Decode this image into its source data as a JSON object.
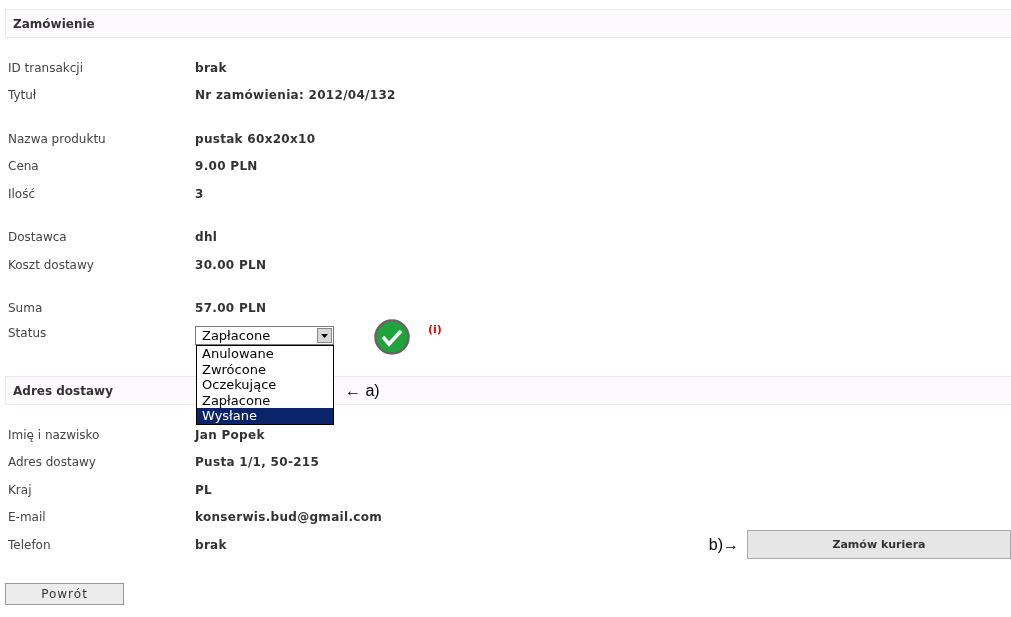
{
  "order": {
    "title": "Zamówienie",
    "groups": [
      [
        {
          "label": "ID transakcji",
          "value": "brak"
        },
        {
          "label": "Tytuł",
          "value": "Nr zamówienia: 2012/04/132"
        }
      ],
      [
        {
          "label": "Nazwa produktu",
          "value": "pustak 60x20x10"
        },
        {
          "label": "Cena",
          "value": "9.00 PLN"
        },
        {
          "label": "Ilość",
          "value": "3"
        }
      ],
      [
        {
          "label": "Dostawca",
          "value": "dhl"
        },
        {
          "label": "Koszt dostawy",
          "value": "30.00 PLN"
        }
      ],
      [
        {
          "label": "Suma",
          "value": "57.00 PLN"
        }
      ]
    ],
    "status": {
      "label": "Status",
      "value": "Zapłacone",
      "expanded": true,
      "options": [
        {
          "label": "Anulowane",
          "highlighted": false
        },
        {
          "label": "Zwrócone",
          "highlighted": false
        },
        {
          "label": "Oczekujące",
          "highlighted": false
        },
        {
          "label": "Zapłacone",
          "highlighted": false
        },
        {
          "label": "Wysłane",
          "highlighted": true
        }
      ],
      "info": "(i)"
    }
  },
  "annotation_a": "← a)",
  "address": {
    "title": "Adres dostawy",
    "rows": [
      {
        "label": "Imię i nazwisko",
        "value": "Jan Popek"
      },
      {
        "label": "Adres dostawy",
        "value": "Pusta 1/1, 50-215"
      },
      {
        "label": "Kraj",
        "value": "PL"
      },
      {
        "label": "E-mail",
        "value": "konserwis.bud@gmail.com"
      },
      {
        "label": "Telefon",
        "value": "brak"
      }
    ]
  },
  "annotation_b": "b)→",
  "courier_button": "Zamów kuriera",
  "back_button": "Powrót"
}
